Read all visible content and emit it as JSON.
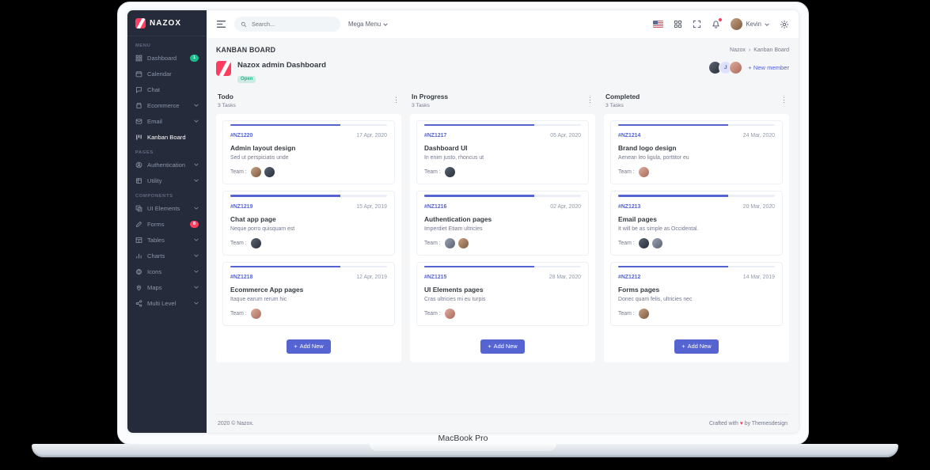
{
  "device": {
    "label": "MacBook Pro"
  },
  "brand": {
    "name": "NAZOX"
  },
  "sidebar": {
    "sections": [
      {
        "title": "MENU",
        "items": [
          {
            "label": "Dashboard",
            "badge": "1"
          },
          {
            "label": "Calendar"
          },
          {
            "label": "Chat"
          },
          {
            "label": "Ecommerce"
          },
          {
            "label": "Email"
          },
          {
            "label": "Kanban Board"
          }
        ]
      },
      {
        "title": "PAGES",
        "items": [
          {
            "label": "Authentication"
          },
          {
            "label": "Utility"
          }
        ]
      },
      {
        "title": "COMPONENTS",
        "items": [
          {
            "label": "UI Elements"
          },
          {
            "label": "Forms",
            "badge": "8"
          },
          {
            "label": "Tables"
          },
          {
            "label": "Charts"
          },
          {
            "label": "Icons"
          },
          {
            "label": "Maps"
          },
          {
            "label": "Multi Level"
          }
        ]
      }
    ]
  },
  "header": {
    "search_placeholder": "Search...",
    "mega_menu_label": "Mega Menu",
    "user_name": "Kevin"
  },
  "page": {
    "title": "KANBAN BOARD",
    "breadcrumb_root": "Nazox",
    "breadcrumb_sep": "›",
    "breadcrumb_current": "Kanban Board"
  },
  "board": {
    "title": "Nazox admin Dashboard",
    "status": "Open",
    "member_initial": "J",
    "new_member_plus": "+",
    "new_member_label": "New member"
  },
  "team_label": "Team :",
  "columns": [
    {
      "name": "Todo",
      "count": "3 Tasks",
      "add_plus": "+",
      "add_label": "Add New",
      "cards": [
        {
          "id": "#NZ1220",
          "date": "17 Apr, 2020",
          "title": "Admin layout design",
          "desc": "Sed ut perspiciatis unde",
          "team_count": 2
        },
        {
          "id": "#NZ1219",
          "date": "15 Apr, 2019",
          "title": "Chat app page",
          "desc": "Neque porro quisquam est",
          "team_count": 1
        },
        {
          "id": "#NZ1218",
          "date": "12 Apr, 2019",
          "title": "Ecommerce App pages",
          "desc": "Itaque earum rerum hic",
          "team_count": 1
        }
      ]
    },
    {
      "name": "In Progress",
      "count": "3 Tasks",
      "add_plus": "+",
      "add_label": "Add New",
      "cards": [
        {
          "id": "#NZ1217",
          "date": "05 Apr, 2020",
          "title": "Dashboard UI",
          "desc": "In enim justo, rhoncus ut",
          "team_count": 1
        },
        {
          "id": "#NZ1216",
          "date": "02 Apr, 2020",
          "title": "Authentication pages",
          "desc": "Imperdiet Etiam ultricies",
          "team_count": 2
        },
        {
          "id": "#NZ1215",
          "date": "28 Mar, 2020",
          "title": "UI Elements pages",
          "desc": "Cras ultricies mi eu turpis",
          "team_count": 1
        }
      ]
    },
    {
      "name": "Completed",
      "count": "3 Tasks",
      "add_plus": "+",
      "add_label": "Add New",
      "cards": [
        {
          "id": "#NZ1214",
          "date": "24 Mar, 2020",
          "title": "Brand logo design",
          "desc": "Aenean leo ligula, porttitor eu",
          "team_count": 1
        },
        {
          "id": "#NZ1213",
          "date": "20 Mar, 2020",
          "title": "Email pages",
          "desc": "It will be as simple as Occidental.",
          "team_count": 2
        },
        {
          "id": "#NZ1212",
          "date": "14 Mar, 2019",
          "title": "Forms pages",
          "desc": "Donec quam felis, ultricies nec",
          "team_count": 1
        }
      ]
    }
  ],
  "footer": {
    "left": "2020 © Nazox.",
    "right_prefix": "Crafted with",
    "heart": "♥",
    "right_suffix": "by Themesdesign"
  },
  "colors": {
    "primary": "#5664d2",
    "danger": "#ff3d60",
    "success": "#1cbb8c",
    "sidebar": "#252b3b"
  }
}
